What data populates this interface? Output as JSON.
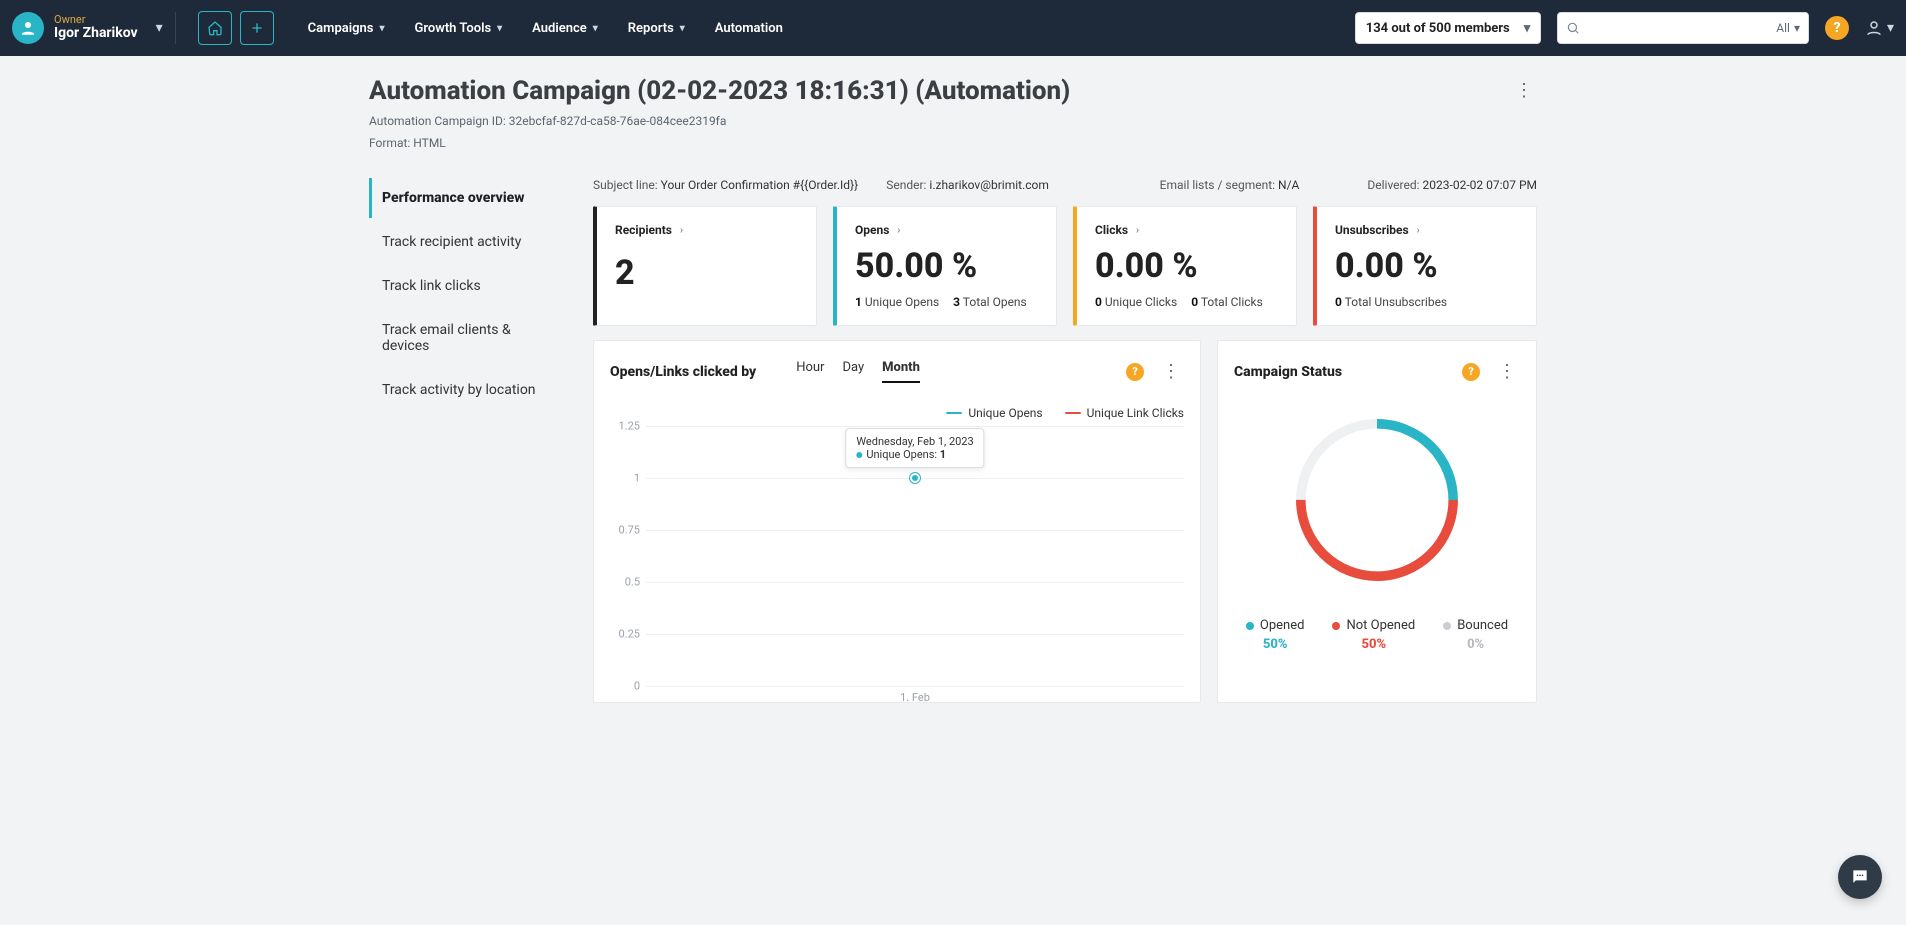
{
  "header": {
    "owner_role": "Owner",
    "owner_name": "Igor Zharikov",
    "nav": [
      "Campaigns",
      "Growth Tools",
      "Audience",
      "Reports",
      "Automation"
    ],
    "members_badge": "134 out of 500 members",
    "search_placeholder": "",
    "search_scope": "All"
  },
  "page": {
    "title": "Automation Campaign (02-02-2023 18:16:31) (Automation)",
    "id_line": "Automation Campaign ID: 32ebcfaf-827d-ca58-76ae-084cee2319fa",
    "format_line": "Format: HTML"
  },
  "side_tabs": [
    "Performance overview",
    "Track recipient activity",
    "Track link clicks",
    "Track email clients & devices",
    "Track activity by location"
  ],
  "info_row": {
    "subject_label": "Subject line:",
    "subject_value": "Your Order Confirmation #{{Order.Id}}",
    "sender_label": "Sender:",
    "sender_value": "i.zharikov@brimit.com",
    "segment_label": "Email lists / segment:",
    "segment_value": "N/A",
    "delivered_label": "Delivered:",
    "delivered_value": "2023-02-02 07:07 PM"
  },
  "stats": {
    "recipients": {
      "label": "Recipients",
      "value": "2"
    },
    "opens": {
      "label": "Opens",
      "rate": "50.00 %",
      "unique_n": "1",
      "unique_l": "Unique Opens",
      "total_n": "3",
      "total_l": "Total Opens"
    },
    "clicks": {
      "label": "Clicks",
      "rate": "0.00 %",
      "unique_n": "0",
      "unique_l": "Unique Clicks",
      "total_n": "0",
      "total_l": "Total Clicks"
    },
    "unsubs": {
      "label": "Unsubscribes",
      "rate": "0.00 %",
      "total_n": "0",
      "total_l": "Total Unsubscribes"
    }
  },
  "opens_chart": {
    "title": "Opens/Links clicked by",
    "time_tabs": [
      "Hour",
      "Day",
      "Month"
    ],
    "active_tab": "Month",
    "legend": {
      "opens": "Unique Opens",
      "clicks": "Unique Link Clicks"
    },
    "tooltip_date": "Wednesday, Feb 1, 2023",
    "tooltip_series": "Unique Opens:",
    "tooltip_value": "1",
    "xlabel": "1. Feb"
  },
  "status_panel": {
    "title": "Campaign Status",
    "opened_label": "Opened",
    "opened_pct": "50%",
    "notopened_label": "Not Opened",
    "notopened_pct": "50%",
    "bounced_label": "Bounced",
    "bounced_pct": "0%"
  },
  "colors": {
    "teal": "#2ab5c7",
    "red": "#e74c3c",
    "orange": "#f5a623",
    "gray": "#c9ccd1"
  },
  "chart_data": [
    {
      "type": "line",
      "title": "Opens/Links clicked by Month",
      "x": [
        "1. Feb"
      ],
      "ylim": [
        0,
        1.25
      ],
      "yticks": [
        0,
        0.25,
        0.5,
        0.75,
        1,
        1.25
      ],
      "series": [
        {
          "name": "Unique Opens",
          "values": [
            1
          ]
        },
        {
          "name": "Unique Link Clicks",
          "values": [
            0
          ]
        }
      ]
    },
    {
      "type": "pie",
      "title": "Campaign Status",
      "categories": [
        "Opened",
        "Not Opened",
        "Bounced"
      ],
      "values": [
        50,
        50,
        0
      ]
    }
  ]
}
